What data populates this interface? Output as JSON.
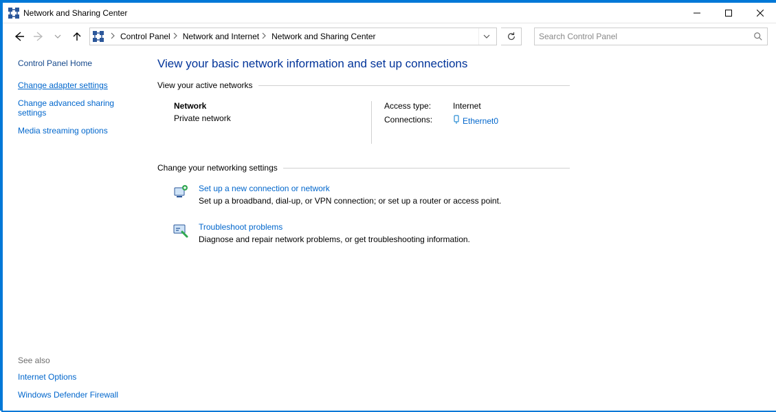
{
  "window": {
    "title": "Network and Sharing Center"
  },
  "breadcrumb": {
    "items": [
      "Control Panel",
      "Network and Internet",
      "Network and Sharing Center"
    ]
  },
  "search": {
    "placeholder": "Search Control Panel"
  },
  "sidebar": {
    "home": "Control Panel Home",
    "links": [
      "Change adapter settings",
      "Change advanced sharing settings",
      "Media streaming options"
    ],
    "see_also_label": "See also",
    "see_also": [
      "Internet Options",
      "Windows Defender Firewall"
    ]
  },
  "main": {
    "heading": "View your basic network information and set up connections",
    "section_active": "View your active networks",
    "network": {
      "name": "Network",
      "type": "Private network",
      "access_label": "Access type:",
      "access_value": "Internet",
      "connections_label": "Connections:",
      "connection_name": "Ethernet0"
    },
    "section_change": "Change your networking settings",
    "actions": {
      "setup": {
        "title": "Set up a new connection or network",
        "desc": "Set up a broadband, dial-up, or VPN connection; or set up a router or access point."
      },
      "troubleshoot": {
        "title": "Troubleshoot problems",
        "desc": "Diagnose and repair network problems, or get troubleshooting information."
      }
    }
  }
}
